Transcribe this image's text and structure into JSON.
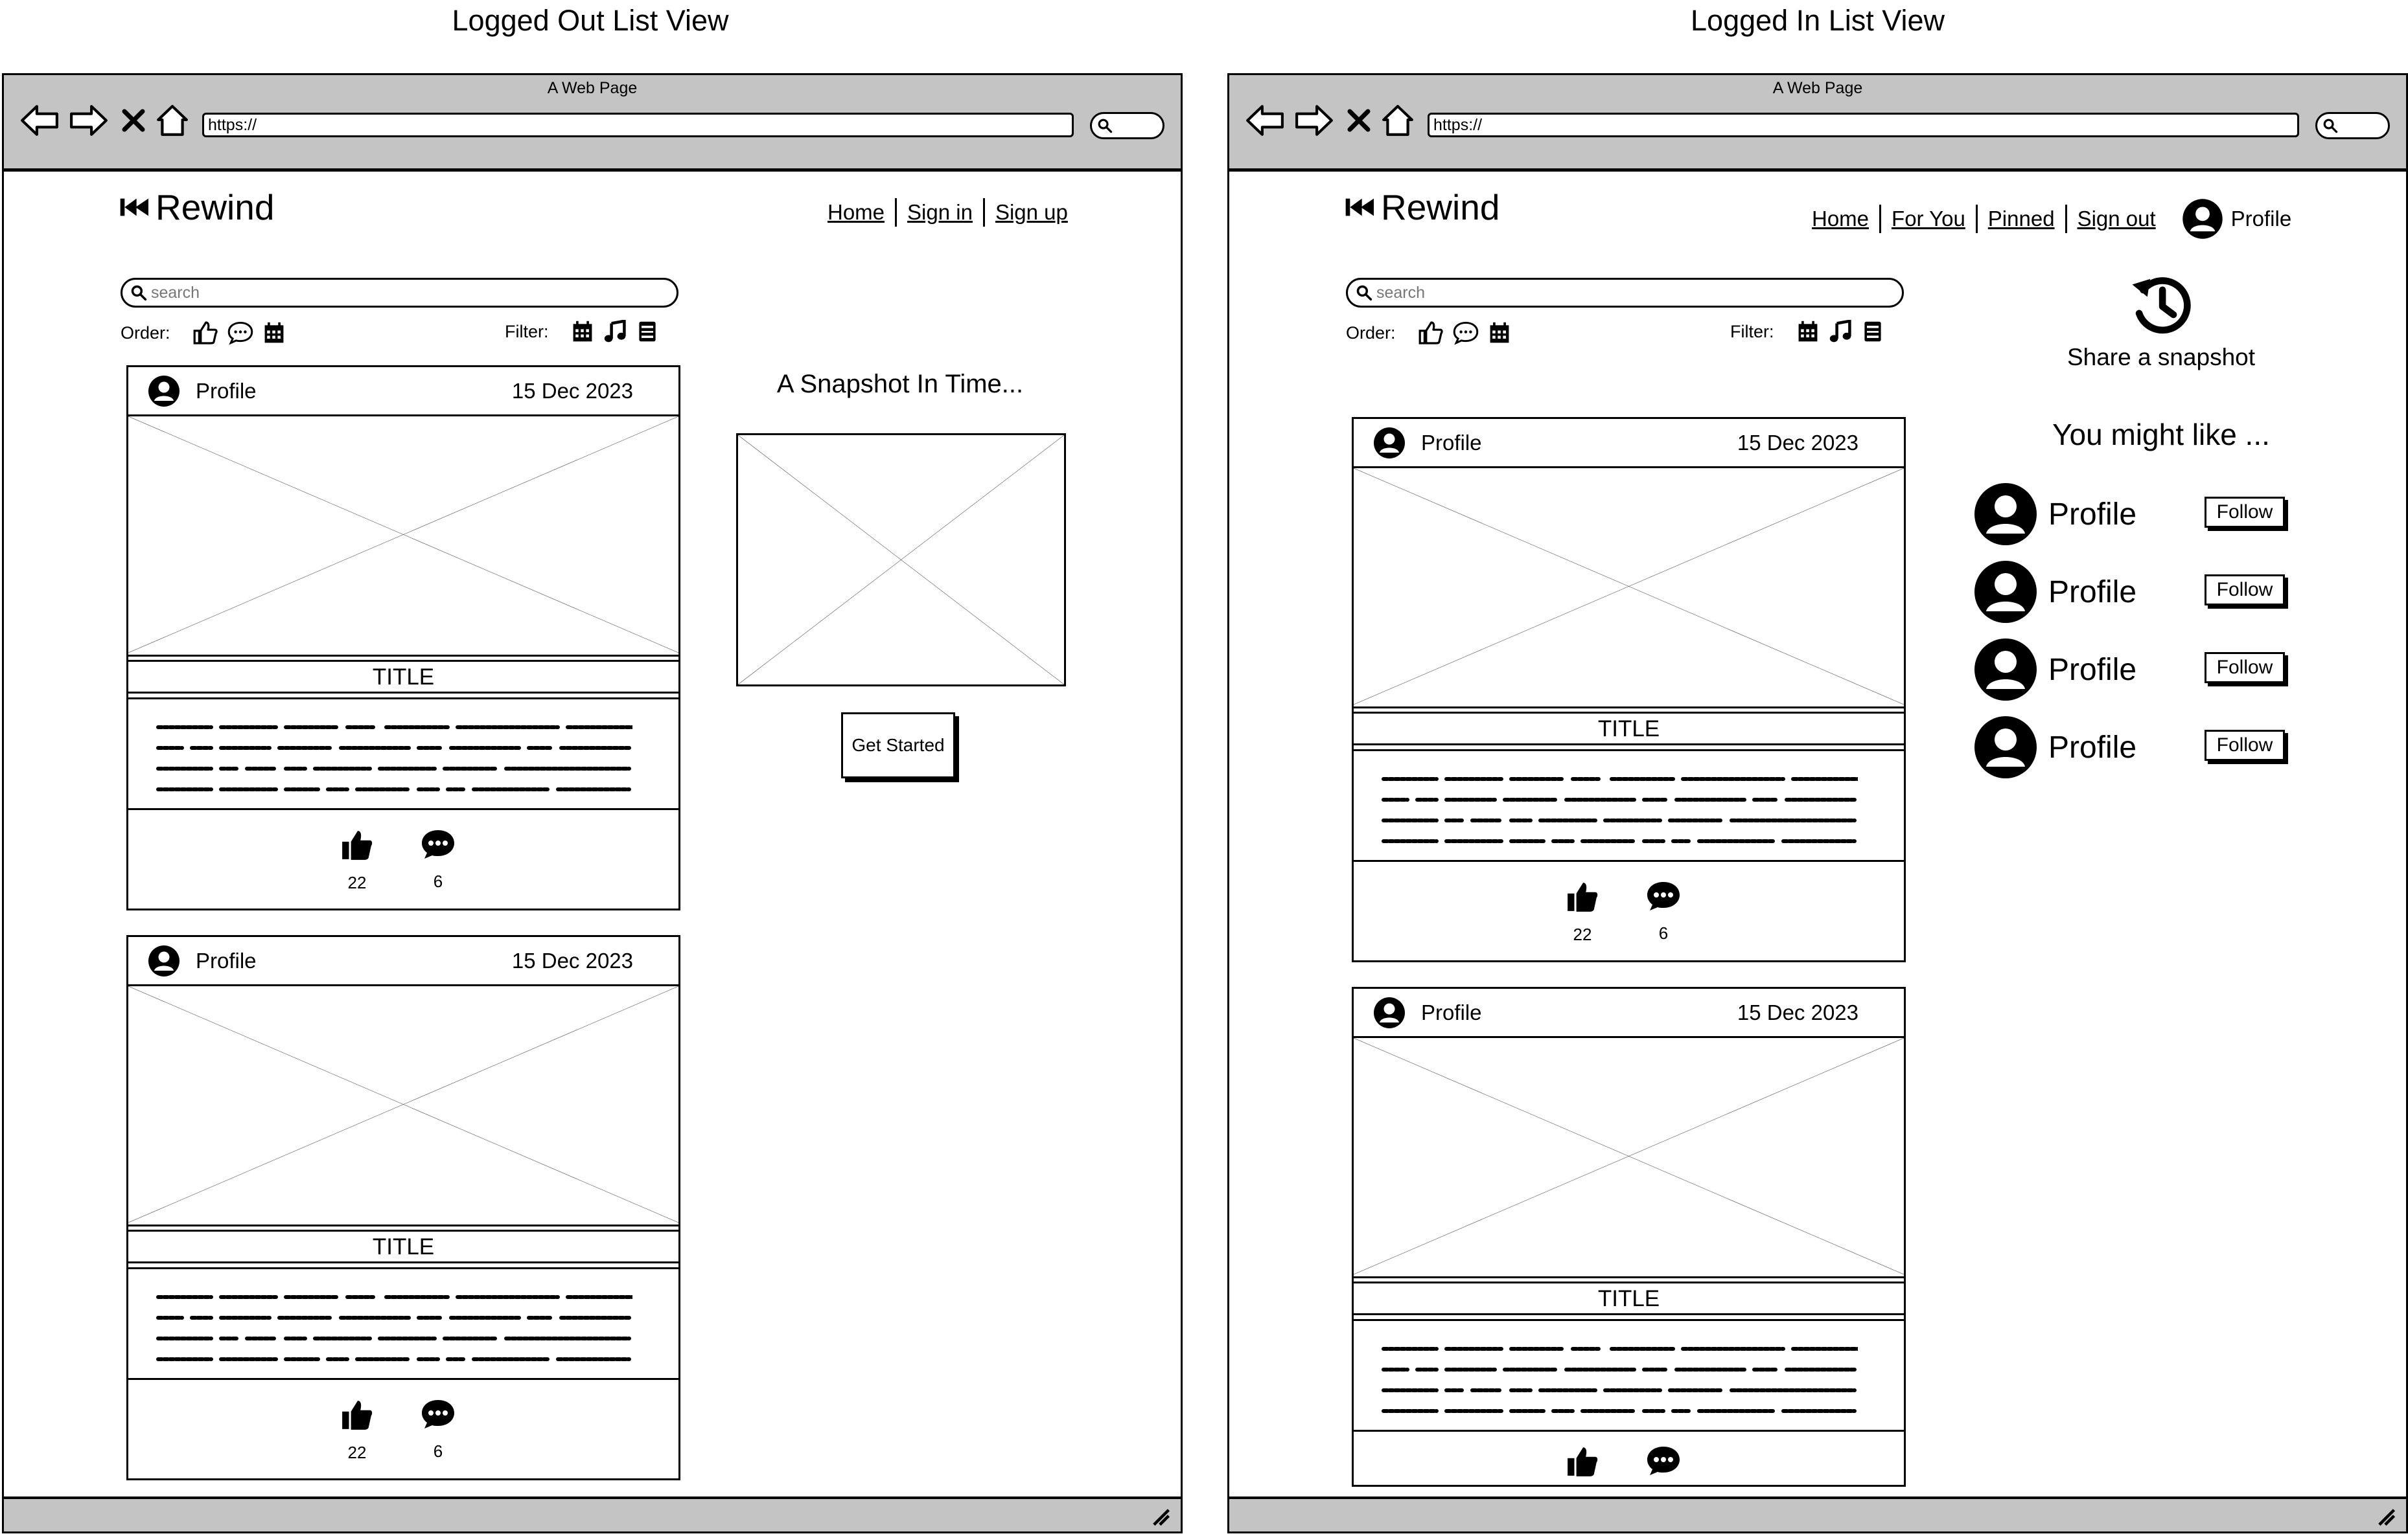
{
  "views": {
    "left": {
      "title": "Logged Out List View",
      "browser": {
        "tab_title": "A Web Page",
        "url": "https://"
      },
      "logo": "Rewind",
      "nav": [
        "Home",
        "Sign in",
        "Sign up"
      ],
      "search_placeholder": "search",
      "order_label": "Order:",
      "filter_label": "Filter:",
      "side": {
        "heading": "A Snapshot In Time...",
        "cta": "Get Started"
      },
      "posts": [
        {
          "author": "Profile",
          "date": "15 Dec 2023",
          "title": "TITLE",
          "likes": "22",
          "comments": "6"
        },
        {
          "author": "Profile",
          "date": "15 Dec 2023",
          "title": "TITLE",
          "likes": "22",
          "comments": "6"
        }
      ]
    },
    "right": {
      "title": "Logged In List View",
      "browser": {
        "tab_title": "A Web Page",
        "url": "https://"
      },
      "logo": "Rewind",
      "nav": [
        "Home",
        "For You",
        "Pinned",
        "Sign out"
      ],
      "profile_label": "Profile",
      "search_placeholder": "search",
      "order_label": "Order:",
      "filter_label": "Filter:",
      "share_label": "Share a snapshot",
      "suggest_heading": "You might like ...",
      "suggestions": [
        {
          "name": "Profile",
          "button": "Follow"
        },
        {
          "name": "Profile",
          "button": "Follow"
        },
        {
          "name": "Profile",
          "button": "Follow"
        },
        {
          "name": "Profile",
          "button": "Follow"
        }
      ],
      "posts": [
        {
          "author": "Profile",
          "date": "15 Dec 2023",
          "title": "TITLE",
          "likes": "22",
          "comments": "6"
        },
        {
          "author": "Profile",
          "date": "15 Dec 2023",
          "title": "TITLE"
        }
      ]
    }
  }
}
